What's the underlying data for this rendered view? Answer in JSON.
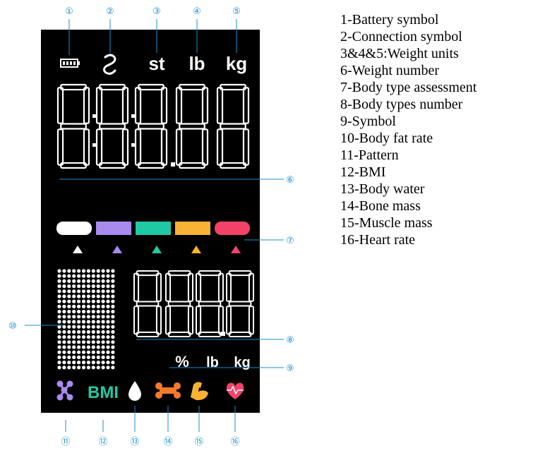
{
  "display": {
    "background": "#000000",
    "segment_color": "#ffffff",
    "top_units": [
      "st",
      "lb",
      "kg"
    ],
    "bottom_units": [
      "%",
      "lb",
      "kg"
    ],
    "main_digits": "88:8:8.8",
    "sub_digits": "888.8",
    "body_type_colors": [
      "#ffffff",
      "#a98bf0",
      "#1fc9a4",
      "#f9b233",
      "#f2426a"
    ],
    "icons": [
      {
        "name": "pattern-icon",
        "color": "#a98bf0"
      },
      {
        "name": "bmi-label",
        "text": "BMI",
        "color": "#1fc9a4"
      },
      {
        "name": "water-drop-icon",
        "color": "#ffffff"
      },
      {
        "name": "bone-icon",
        "color": "#f57a2a"
      },
      {
        "name": "muscle-icon",
        "color": "#f9b233"
      },
      {
        "name": "heart-rate-icon",
        "color": "#f2426a"
      }
    ]
  },
  "callouts": {
    "color": "#1a8fd1",
    "numbers": [
      "①",
      "②",
      "③",
      "④",
      "⑤",
      "⑥",
      "⑦",
      "⑧",
      "⑨",
      "⑩",
      "⑪",
      "⑫",
      "⑬",
      "⑭",
      "⑮",
      "⑯"
    ]
  },
  "legend": [
    "1-Battery symbol",
    "2-Connection symbol",
    "3&4&5:Weight units",
    "6-Weight number",
    "7-Body type assessment",
    "8-Body types number",
    "9-Symbol",
    "10-Body fat rate",
    "11-Pattern",
    "12-BMI",
    "13-Body water",
    "14-Bone mass",
    "15-Muscle mass",
    "16-Heart rate"
  ]
}
